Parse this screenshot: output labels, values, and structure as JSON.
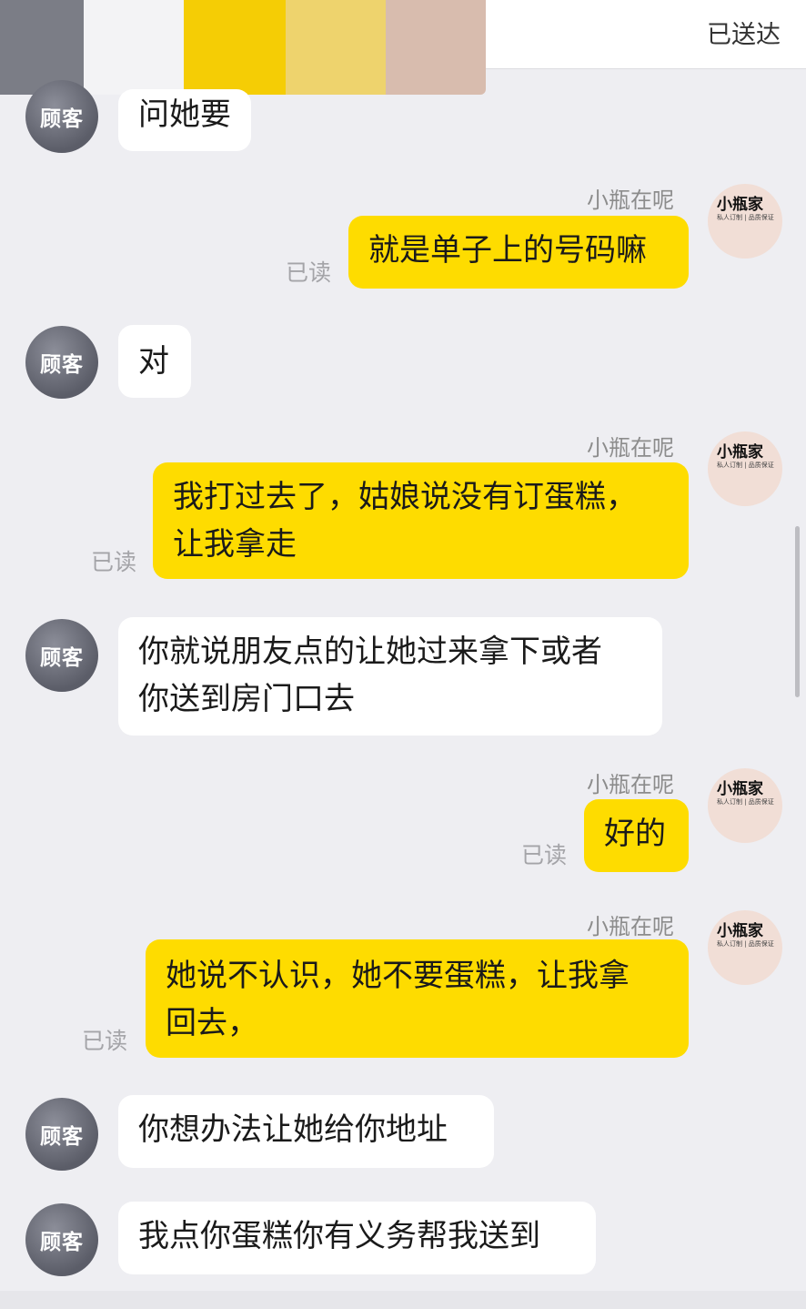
{
  "header": {
    "status": "已送达",
    "swatch_colors": [
      "#7b7d86",
      "#f3f3f5",
      "#f5cd05",
      "#eed36d",
      "#d8bcae"
    ]
  },
  "labels": {
    "customer_avatar": "顾客",
    "shop_name": "小瓶在呢",
    "read_status": "已读",
    "shop_avatar_text": "小瓶家",
    "shop_avatar_sub": "私人订制 | 品质保证"
  },
  "messages": [
    {
      "role": "customer",
      "text": "问她要"
    },
    {
      "role": "shop",
      "text": "就是单子上的号码嘛",
      "read": "已读"
    },
    {
      "role": "customer",
      "text": "对"
    },
    {
      "role": "shop",
      "lines": [
        "我打过去了，姑娘说没有订蛋糕，",
        "让我拿走"
      ],
      "read": "已读"
    },
    {
      "role": "customer",
      "lines": [
        "你就说朋友点的让她过来拿下或者",
        "你送到房门口去"
      ]
    },
    {
      "role": "shop",
      "text": "好的",
      "read": "已读"
    },
    {
      "role": "shop",
      "lines": [
        "她说不认识，她不要蛋糕，让我拿",
        "回去，"
      ],
      "read": "已读"
    },
    {
      "role": "customer",
      "text": "你想办法让她给你地址"
    },
    {
      "role": "customer",
      "text": "我点你蛋糕你有义务帮我送到"
    }
  ],
  "colors": {
    "background": "#eeeef2",
    "shop_bubble": "#fedc00",
    "customer_bubble": "#ffffff",
    "customer_avatar": "#6a6c77"
  }
}
